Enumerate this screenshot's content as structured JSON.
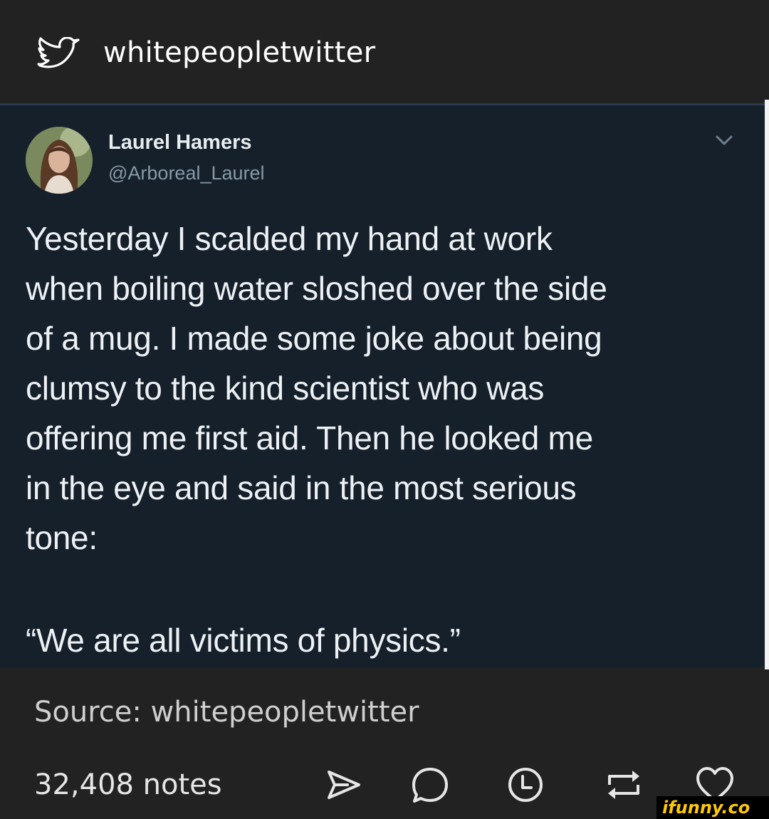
{
  "header": {
    "blog_name": "whitepeopletwitter",
    "icon": "twitter-bird-icon"
  },
  "tweet": {
    "author_name": "Laurel Hamers",
    "author_handle": "@Arboreal_Laurel",
    "menu_icon": "chevron-down-icon",
    "text": "Yesterday I scalded my hand at work\nwhen boiling water sloshed over the side\nof a mug. I made some joke about being\nclumsy to the kind scientist who was\noffering me first aid. Then he looked me\nin the eye and said in the most serious\ntone:",
    "quote": "“We are all victims of physics.”",
    "colors": {
      "background": "#15202b",
      "text": "#eef1f4",
      "handle": "#8899a6"
    }
  },
  "source": {
    "text": "Source: whitepeopletwitter"
  },
  "footer": {
    "notes": "32,408 notes",
    "actions": [
      {
        "name": "share",
        "icon": "send-icon"
      },
      {
        "name": "reply",
        "icon": "comment-icon"
      },
      {
        "name": "queue",
        "icon": "clock-icon"
      },
      {
        "name": "reblog",
        "icon": "reblog-icon"
      },
      {
        "name": "like",
        "icon": "heart-icon"
      }
    ]
  },
  "watermark": {
    "text": "ifunny.co",
    "color": "#ffc800"
  },
  "colors": {
    "page_background": "#222222",
    "primary_text": "#ffffff",
    "secondary_text": "#cfcfcf"
  }
}
